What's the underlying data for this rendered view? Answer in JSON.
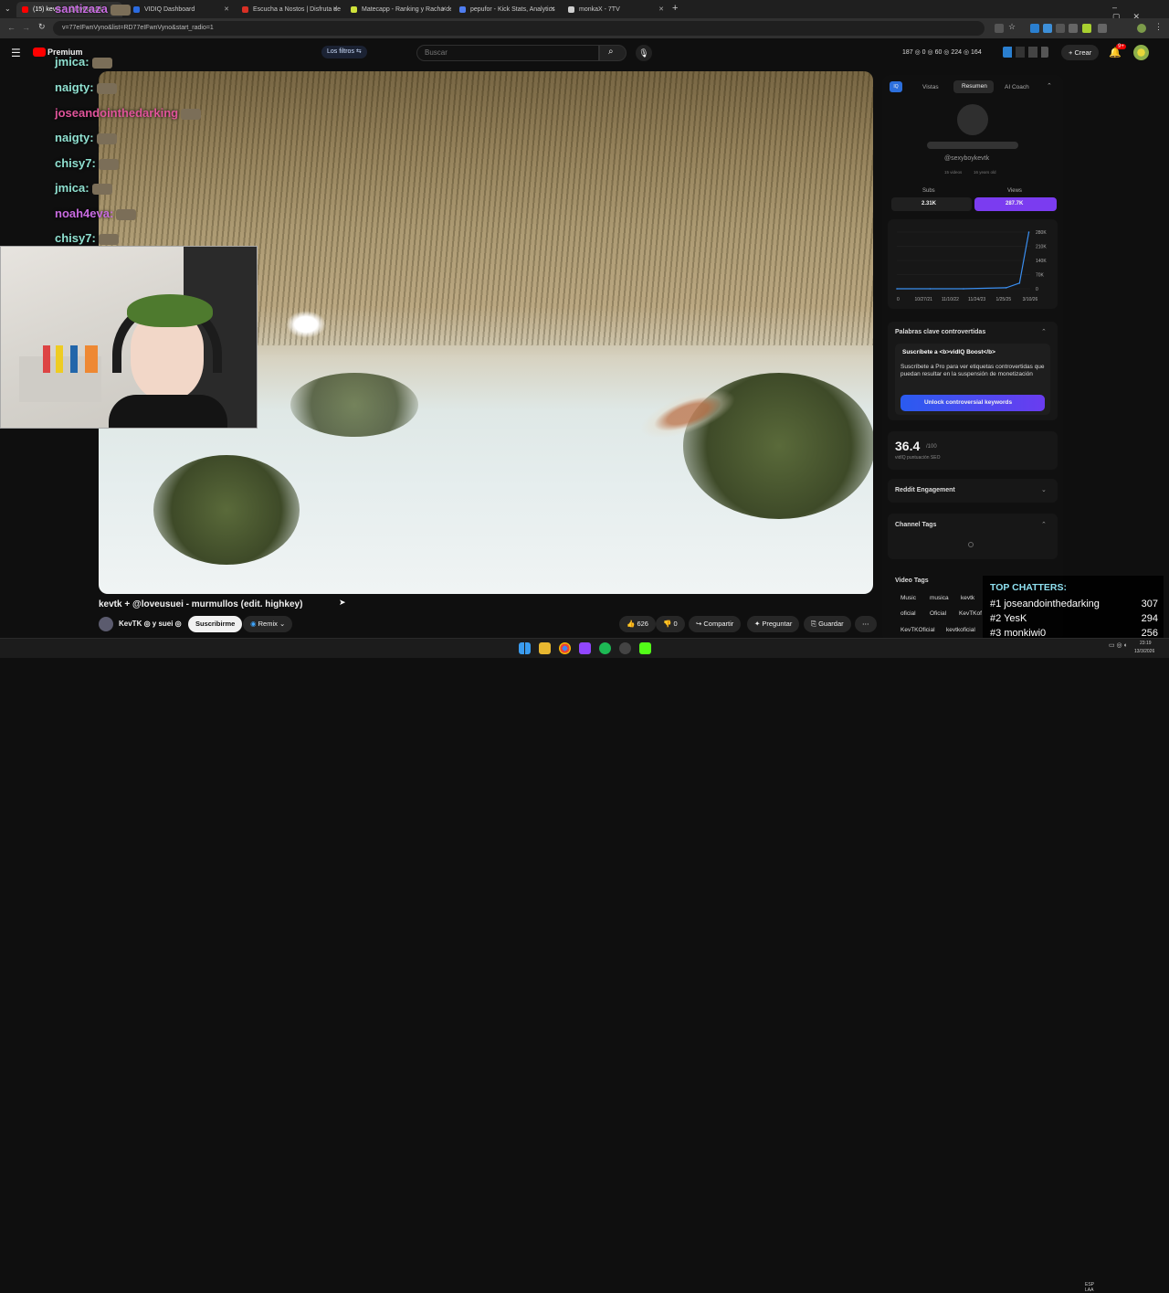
{
  "browser": {
    "tabs": [
      {
        "label": "(15) kevtk + @loveusuei",
        "x": 18,
        "active": true,
        "color": "#ff0000"
      },
      {
        "label": "VIDIQ Dashboard",
        "x": 140,
        "active": false,
        "color": "#2b6be0"
      },
      {
        "label": "Escucha a Nostos | Disfruta de",
        "x": 259,
        "active": false,
        "color": "#d93025"
      },
      {
        "label": "Matecapp - Ranking y Racha de",
        "x": 378,
        "active": false,
        "color": "#cfe23a"
      },
      {
        "label": "pepufor - Kick Stats, Analytics",
        "x": 497,
        "active": false,
        "color": "#4f7df0"
      },
      {
        "label": "monkaX - 7TV",
        "x": 616,
        "active": false,
        "color": "#cfcfcf"
      }
    ],
    "new_tab": "+",
    "url": "v=77eIFwnVyno&list=RD77eIFwnVyno&start_radio=1"
  },
  "yt": {
    "logo": "Premium",
    "filter_chip": "Los filtros",
    "search_placeholder": "Buscar",
    "stats": "187  ◎ 0  ◎ 60  ◎ 224  ◎ 164",
    "create_label": "Crear",
    "notif_badge": "9+"
  },
  "chat": [
    {
      "user": "santizaza",
      "color": "#c86be0",
      "top": 0
    },
    {
      "user": "jmica:",
      "color": "#8fe0d0",
      "top": 26
    },
    {
      "user": "naigty:",
      "color": "#8fe0d0",
      "top": 54
    },
    {
      "user": "joseandointhedarking",
      "color": "#e0549a",
      "top": 82
    },
    {
      "user": "naigty:",
      "color": "#8fe0d0",
      "top": 109
    },
    {
      "user": "chisy7:",
      "color": "#8fe0d0",
      "top": 137
    },
    {
      "user": "jmica:",
      "color": "#8fe0d0",
      "top": 164
    },
    {
      "user": "noah4eva:",
      "color": "#c86be0",
      "top": 192
    },
    {
      "user": "chisy7:",
      "color": "#8fe0d0",
      "top": 219
    },
    {
      "user": "chisy7:",
      "color": "#8fe0d0",
      "top": 247
    }
  ],
  "video": {
    "title": "kevtk + @loveusuei - murmullos (edit. highkey)",
    "channel": "KevTK ◎ y suei ◎",
    "subscribe": "Suscribirme",
    "remix": "Remix",
    "likes": "626",
    "dislikes": "0",
    "share": "Compartir",
    "ask": "Preguntar",
    "save": "Guardar"
  },
  "vidiq": {
    "tabs": [
      "Vistas",
      "Resumen",
      "AI Coach"
    ],
    "handle": "@sexyboykevtk",
    "videos_meta": "15 videos",
    "age_meta": "16 years old",
    "subs_label": "Subs",
    "views_label": "Views",
    "subs_value": "2.31K",
    "views_value": "287.7K",
    "chart_yticks": [
      "280K",
      "210K",
      "140K",
      "70K",
      "0"
    ],
    "chart_xticks": [
      "0",
      "10/27/21",
      "11/10/22",
      "11/24/23",
      "1/25/25",
      "3/10/26"
    ],
    "keywords_header": "Palabras clave controvertidas",
    "boost_title": "Suscríbete a <b>vidIQ Boost</b>",
    "boost_body": "Suscríbete a Pro para ver etiquetas controvertidas que puedan resultar en la suspensión de monetización",
    "unlock_button": "Unlock controversial keywords",
    "seo_score": "36.4",
    "seo_max": "/100",
    "seo_label": "vidIQ puntuación SEO",
    "reddit": "Reddit Engagement",
    "channel_tags": "Channel Tags",
    "video_tags": "Video Tags",
    "tags": [
      "Music",
      "musica",
      "kevtk",
      "oficial",
      "Oficial",
      "KevTKof",
      "KevTKOficial",
      "kevtkoficial"
    ]
  },
  "chart_data": {
    "type": "line",
    "x": [
      "10/27/21",
      "11/10/22",
      "11/24/23",
      "1/25/25",
      "3/10/26"
    ],
    "values": [
      0,
      0,
      0,
      5,
      280
    ],
    "ylim": [
      0,
      280
    ],
    "ylabel": "",
    "yticks": [
      "280K",
      "210K",
      "140K",
      "70K",
      "0"
    ],
    "series": [
      {
        "name": "Views",
        "values": [
          0,
          0,
          0,
          5,
          280
        ]
      }
    ]
  },
  "top_chatters": {
    "header": "TOP CHATTERS:",
    "rows": [
      {
        "rank": "#1",
        "name": "joseandointhedarking",
        "count": "307"
      },
      {
        "rank": "#2",
        "name": "YesK",
        "count": "294"
      },
      {
        "rank": "#3",
        "name": "monkiwi0",
        "count": "256"
      }
    ]
  },
  "taskbar": {
    "lang": "ESP\nLAA",
    "time": "23:19",
    "date": "13/3/2026"
  }
}
